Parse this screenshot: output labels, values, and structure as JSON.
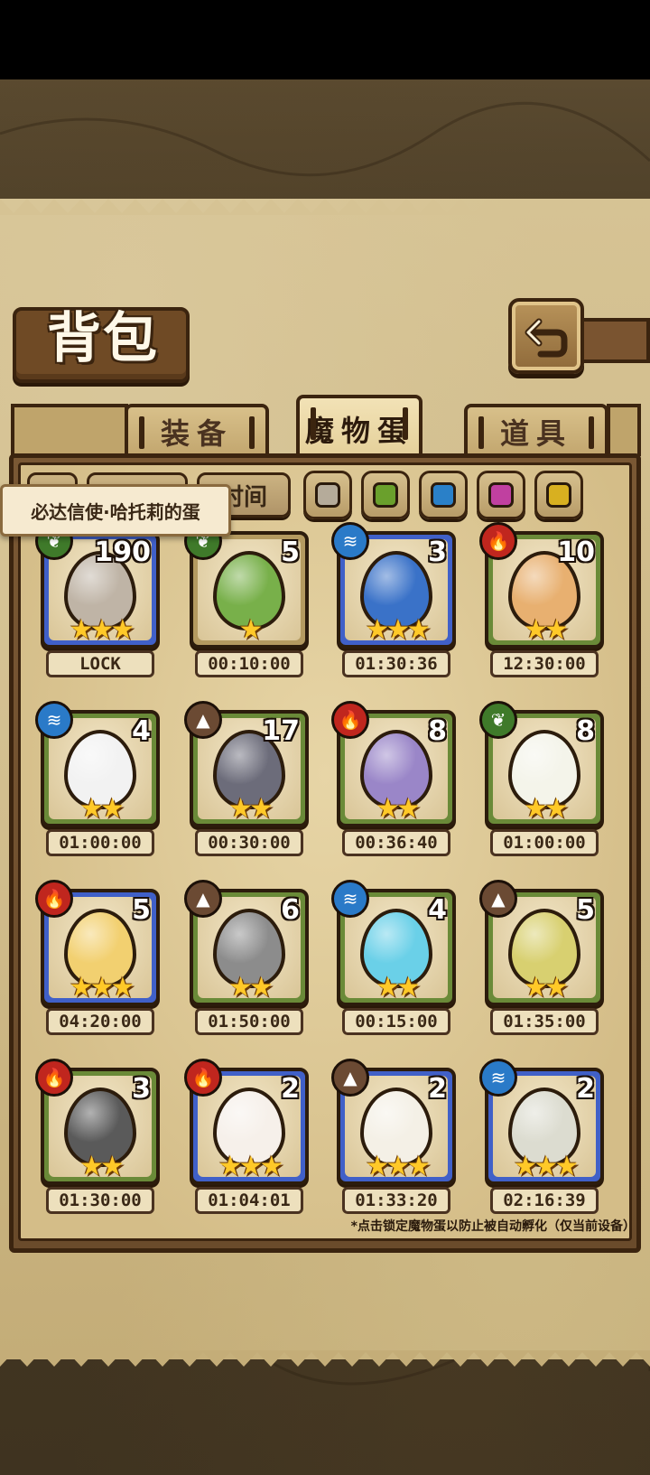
{
  "title": "背包",
  "tabs": [
    {
      "label": "装备",
      "active": false
    },
    {
      "label": "魔物蛋",
      "active": true
    },
    {
      "label": "道具",
      "active": false
    }
  ],
  "filters": {
    "sort_label": "时间",
    "colors": [
      "#b5ab9a",
      "#6aa02c",
      "#2a80c8",
      "#c040a0",
      "#d8b020"
    ]
  },
  "tooltip": "必达信使·哈托莉的蛋",
  "eggs": [
    {
      "count": "190",
      "element": "grass",
      "stars": "★★★",
      "timer": "LOCK",
      "frame": "blue",
      "egg_color": "#bfb4a6"
    },
    {
      "count": "5",
      "element": "grass",
      "stars": "★",
      "timer": "00:10:00",
      "frame": "tan",
      "egg_color": "#78b04a"
    },
    {
      "count": "3",
      "element": "water",
      "stars": "★★★",
      "timer": "01:30:36",
      "frame": "blue",
      "egg_color": "#3a72c8"
    },
    {
      "count": "10",
      "element": "fire",
      "stars": "★★",
      "timer": "12:30:00",
      "frame": "green",
      "egg_color": "#e8b070"
    },
    {
      "count": "4",
      "element": "water",
      "stars": "★★",
      "timer": "01:00:00",
      "frame": "green",
      "egg_color": "#f2f2f2"
    },
    {
      "count": "17",
      "element": "earth",
      "stars": "★★",
      "timer": "00:30:00",
      "frame": "green",
      "egg_color": "#6c6c7a"
    },
    {
      "count": "8",
      "element": "fire",
      "stars": "★★",
      "timer": "00:36:40",
      "frame": "green",
      "egg_color": "#9a86c8"
    },
    {
      "count": "8",
      "element": "grass",
      "stars": "★★",
      "timer": "01:00:00",
      "frame": "green",
      "egg_color": "#f4f4ea"
    },
    {
      "count": "5",
      "element": "fire",
      "stars": "★★★",
      "timer": "04:20:00",
      "frame": "blue",
      "egg_color": "#f2d070"
    },
    {
      "count": "6",
      "element": "earth",
      "stars": "★★",
      "timer": "01:50:00",
      "frame": "green",
      "egg_color": "#8c8c8c"
    },
    {
      "count": "4",
      "element": "water",
      "stars": "★★",
      "timer": "00:15:00",
      "frame": "green",
      "egg_color": "#6ad0e8"
    },
    {
      "count": "5",
      "element": "earth",
      "stars": "★★",
      "timer": "01:35:00",
      "frame": "green",
      "egg_color": "#d8d070"
    },
    {
      "count": "3",
      "element": "fire",
      "stars": "★★",
      "timer": "01:30:00",
      "frame": "green",
      "egg_color": "#5a5a5a"
    },
    {
      "count": "2",
      "element": "fire",
      "stars": "★★★",
      "timer": "01:04:01",
      "frame": "blue",
      "egg_color": "#f6f0ea"
    },
    {
      "count": "2",
      "element": "earth",
      "stars": "★★★",
      "timer": "01:33:20",
      "frame": "blue",
      "egg_color": "#f4f0e6"
    },
    {
      "count": "2",
      "element": "water",
      "stars": "★★★",
      "timer": "02:16:39",
      "frame": "blue",
      "egg_color": "#dcdcd0"
    }
  ],
  "element_icons": {
    "fire": "fire-icon",
    "water": "water-icon",
    "grass": "leaf-icon",
    "earth": "mountain-icon"
  },
  "footnote": "*点击锁定魔物蛋以防止被自动孵化（仅当前设备）"
}
